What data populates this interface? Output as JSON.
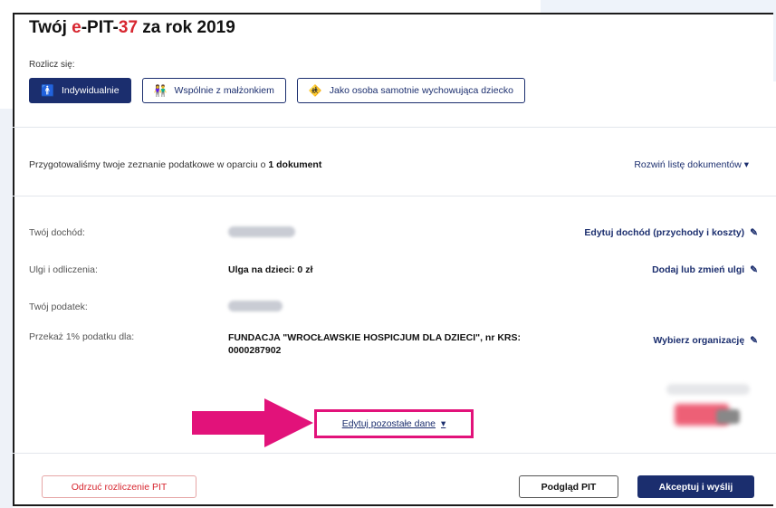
{
  "title": {
    "prefix": "Twój ",
    "accent_e": "e",
    "pit": "-PIT-",
    "accent_num": "37",
    "suffix": " za rok 2019"
  },
  "settlement": {
    "label": "Rozlicz się:",
    "options": [
      {
        "label": "Indywidualnie",
        "icon": "person-icon",
        "active": true
      },
      {
        "label": "Wspólnie z małżonkiem",
        "icon": "couple-icon",
        "active": false
      },
      {
        "label": "Jako osoba samotnie wychowująca dziecko",
        "icon": "parent-child-icon",
        "active": false
      }
    ]
  },
  "prepared": {
    "text": "Przygotowaliśmy twoje zeznanie podatkowe w oparciu o ",
    "bold": "1 dokument",
    "expand_label": "Rozwiń listę dokumentów"
  },
  "rows": [
    {
      "label": "Twój dochód:",
      "value": "",
      "action": "Edytuj dochód (przychody i koszty)"
    },
    {
      "label": "Ulgi i odliczenia:",
      "value": "Ulga na dzieci: 0 zł",
      "action": "Dodaj lub zmień ulgi"
    },
    {
      "label": "Twój podatek:",
      "value": "",
      "action": ""
    },
    {
      "label": "Przekaż 1% podatku dla:",
      "value_line1": "FUNDACJA \"WROCŁAWSKIE HOSPICJUM DLA DZIECI\", nr KRS:",
      "value_line2": "0000287902",
      "action": "Wybierz organizację"
    }
  ],
  "edit_rest": "Edytuj pozostałe dane",
  "footer": {
    "reject": "Odrzuć rozliczenie PIT",
    "preview": "Podgląd PIT",
    "accept": "Akceptuj i wyślij"
  },
  "colors": {
    "navy": "#1b2e6e",
    "red": "#d7262f",
    "highlight": "#e2127a"
  }
}
